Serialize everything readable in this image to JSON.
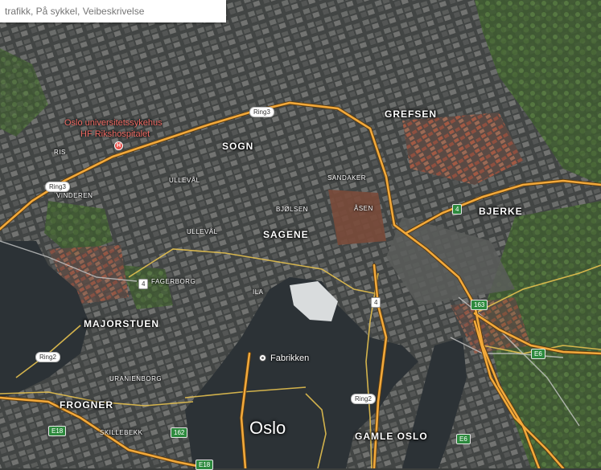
{
  "search": {
    "placeholder": "trafikk, På sykkel, Veibeskrivelse"
  },
  "colors": {
    "water": "#2c3236",
    "road_major": "#f2a93b",
    "road_minor": "#e6c14f",
    "land_dark": "#3b3e3d",
    "land_green": "#4f6b3a",
    "roofs": "#a35a44",
    "city_marker": "#ef6c65"
  },
  "map": {
    "city": "Oslo",
    "hospital": {
      "line1": "Oslo universitetssykehus",
      "line2": "HF Rikshospitalet",
      "icon": "hospital-icon"
    },
    "poi": {
      "name": "Fabrikken",
      "icon": "place-pin-icon"
    },
    "districts": {
      "grefsen": "GREFSEN",
      "sogn": "SOGN",
      "bjerke": "BJERKE",
      "sagene": "SAGENE",
      "majorstuen": "MAJORSTUEN",
      "frogner": "FROGNER",
      "gamle_oslo": "GAMLE OSLO"
    },
    "streets": {
      "ris": "RIS",
      "vinderen": "VINDEREN",
      "ullevaal_1": "ULLEVÅL",
      "ullevaal_2": "ULLEVÅL",
      "sandaker": "SANDAKER",
      "bjolsen": "BJØLSEN",
      "asen": "ÅSEN",
      "fagerborg": "FAGERBORG",
      "ila": "ILA",
      "uranienborg": "URANIENBORG",
      "skillebekk": "SKILLEBEKK"
    },
    "shields": {
      "ring3_a": "Ring3",
      "ring3_b": "Ring3",
      "ring2_a": "Ring2",
      "ring2_b": "Ring2",
      "r4_a": "4",
      "r4_b": "4",
      "r163": "163",
      "e6_a": "E6",
      "e6_b": "E6",
      "e18_a": "E18",
      "e18_b": "E18",
      "r162": "162"
    }
  }
}
